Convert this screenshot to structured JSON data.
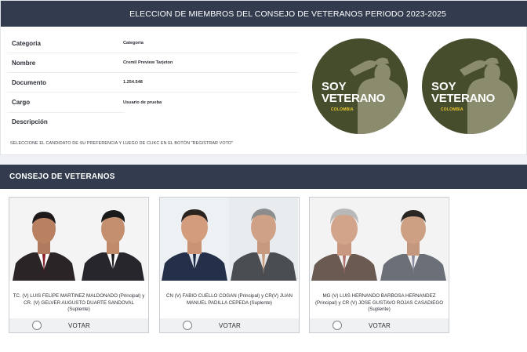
{
  "header": {
    "title": "ELECCION DE MIEMBROS DEL CONSEJO DE VETERANOS PERIODO 2023-2025"
  },
  "info": {
    "rows": [
      {
        "label": "Categoria",
        "value": "Categoria"
      },
      {
        "label": "Nombre",
        "value": "Cremil Preview Tarjeton"
      },
      {
        "label": "Documento",
        "value": "1.254.548"
      },
      {
        "label": "Cargo",
        "value": "Usuario de prueba"
      },
      {
        "label": "Descripción",
        "value": ""
      }
    ],
    "hint": "SELECCIONE EL CANDIDATO DE SU PREFERENCIA Y LUEGO DE CLIKC EN EL BOTÓN \"REGISTRAR VOTO\""
  },
  "logos": [
    {
      "line1": "SOY",
      "line2": "VETERANO",
      "line3": "COLOMBIA"
    },
    {
      "line1": "SOY",
      "line2": "VETERANO",
      "line3": "COLOMBIA"
    }
  ],
  "section": {
    "title": "CONSEJO DE VETERANOS"
  },
  "candidates": [
    {
      "name": "TC. (V) LUIS FELIPE MARTINEZ MALDONADO (Principal) y CR. (V) GELVER AUGUSTO DUARTE SANDOVAL (Suplente)",
      "vote_label": "VOTAR"
    },
    {
      "name": "CN (V) FABIO CUELLO COGAN (Principal) y CR(V) JUAN MANUEL PADILLA CEPEDA (Suplente)",
      "vote_label": "VOTAR"
    },
    {
      "name": "MG (V) LUIS HERNANDO BARBOSA HERNANDEZ (Principal) y CR (V) JOSE GUSTAVO ROJAS CASADIEGO (Suplente)",
      "vote_label": "VOTAR"
    }
  ],
  "colors": {
    "header_bg": "#333c4e",
    "logo_bg": "#454d2c",
    "logo_figure": "#8b8c6e",
    "logo_accent": "#e8c72c"
  }
}
